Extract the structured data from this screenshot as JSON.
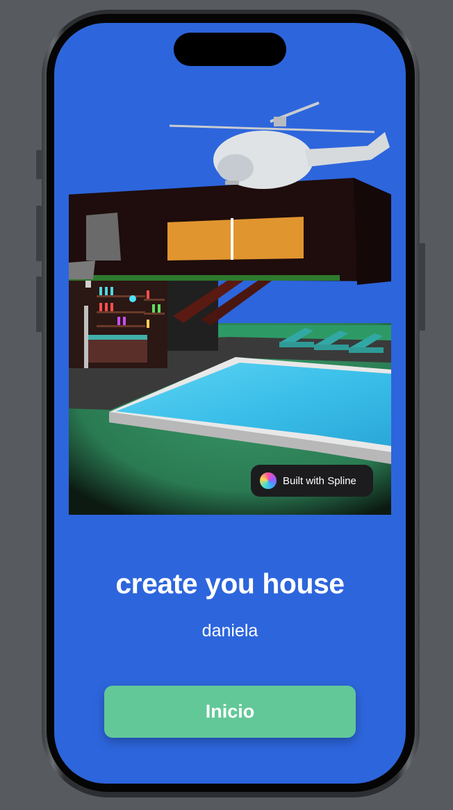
{
  "scene": {
    "badge_label": "Built with Spline",
    "badge_icon": "spline-logo-icon"
  },
  "main": {
    "title": "create you house",
    "subtitle": "daniela",
    "button_label": "Inicio"
  },
  "colors": {
    "background": "#2d65dc",
    "button": "#62c898",
    "text": "#ffffff"
  }
}
